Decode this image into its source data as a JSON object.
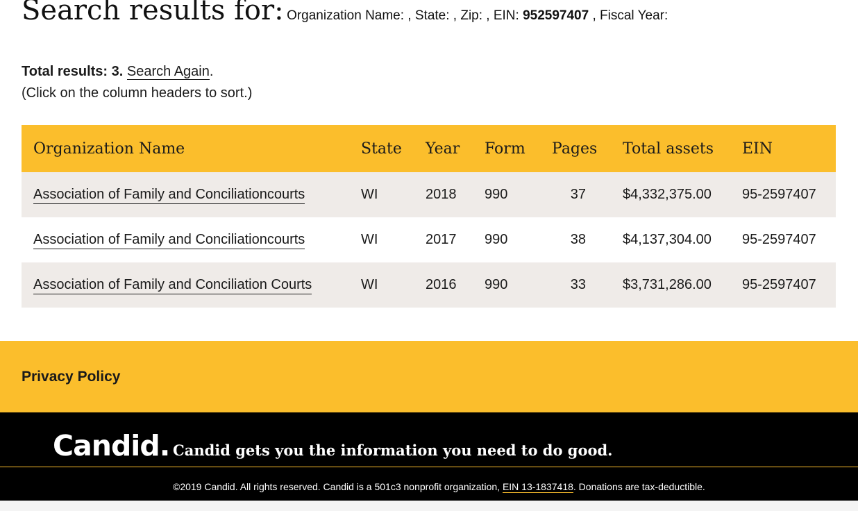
{
  "header": {
    "title": "Search results for:",
    "criteria_prefix": "Organization Name: , State: , Zip: , EIN:",
    "ein_value": "952597407",
    "criteria_suffix": ", Fiscal Year:"
  },
  "summary": {
    "total_label": "Total results: 3.",
    "search_again": "Search Again",
    "period": ".",
    "sort_hint": "(Click on the column headers to sort.)"
  },
  "table": {
    "columns": [
      "Organization Name",
      "State",
      "Year",
      "Form",
      "Pages",
      "Total assets",
      "EIN"
    ],
    "rows": [
      {
        "name": "Association of Family and Conciliationcourts",
        "state": "WI",
        "year": "2018",
        "form": "990",
        "pages": "37",
        "assets": "$4,332,375.00",
        "ein": "95-2597407"
      },
      {
        "name": "Association of Family and Conciliationcourts",
        "state": "WI",
        "year": "2017",
        "form": "990",
        "pages": "38",
        "assets": "$4,137,304.00",
        "ein": "95-2597407"
      },
      {
        "name": "Association of Family and Conciliation Courts",
        "state": "WI",
        "year": "2016",
        "form": "990",
        "pages": "33",
        "assets": "$3,731,286.00",
        "ein": "95-2597407"
      }
    ]
  },
  "privacy": {
    "label": "Privacy Policy"
  },
  "footer": {
    "logo": "Candid.",
    "tagline": "Candid gets you the information you need to do good.",
    "legal_prefix": "©2019 Candid. All rights reserved. Candid is a 501c3 nonprofit organization,",
    "ein_link": "EIN 13-1837418",
    "legal_suffix": ". Donations are tax-deductible."
  },
  "colors": {
    "accent": "#fbbe2c",
    "row_alt": "#efebe8",
    "footer_bg": "#000000"
  }
}
